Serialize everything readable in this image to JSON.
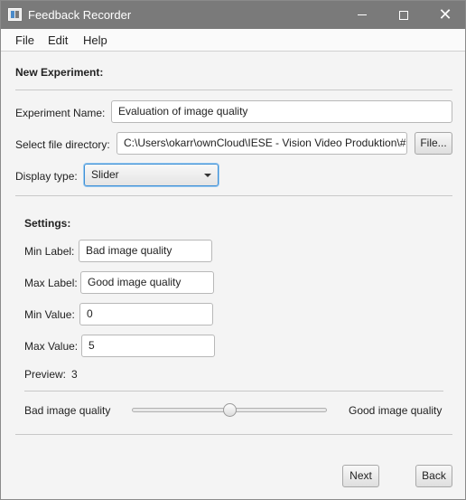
{
  "window": {
    "title": "Feedback Recorder"
  },
  "menu": {
    "items": [
      "File",
      "Edit",
      "Help"
    ]
  },
  "form": {
    "heading": "New Experiment:",
    "experiment_name_label": "Experiment Name:",
    "experiment_name_value": "Evaluation of image quality",
    "file_dir_label": "Select file directory:",
    "file_dir_value": "C:\\Users\\okarr\\ownCloud\\IESE - Vision Video Produktion\\#",
    "file_button": "File...",
    "display_type_label": "Display type:",
    "display_type_value": "Slider"
  },
  "settings": {
    "heading": "Settings:",
    "min_label_label": "Min Label:",
    "min_label_value": "Bad image quality",
    "max_label_label": "Max Label:",
    "max_label_value": "Good image quality",
    "min_value_label": "Min Value:",
    "min_value_value": "0",
    "max_value_label": "Max Value:",
    "max_value_value": "5",
    "preview_label": "Preview:",
    "preview_value": "3",
    "slider": {
      "min": 0,
      "max": 5,
      "value": 2.5,
      "min_text": "Bad image quality",
      "max_text": "Good image quality"
    }
  },
  "footer": {
    "next_button": "Next",
    "back_button": "Back"
  }
}
